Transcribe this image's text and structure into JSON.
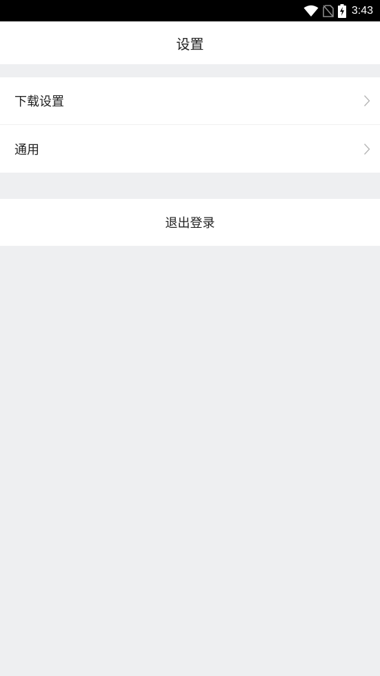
{
  "status_bar": {
    "time": "3:43",
    "icons": [
      "wifi-icon",
      "no-sim-icon",
      "battery-charging-icon"
    ]
  },
  "header": {
    "title": "设置"
  },
  "settings": {
    "items": [
      {
        "label": "下载设置",
        "icon": "chevron-right-icon"
      },
      {
        "label": "通用",
        "icon": "chevron-right-icon"
      }
    ]
  },
  "logout": {
    "label": "退出登录"
  },
  "colors": {
    "background": "#eeeff1",
    "surface": "#ffffff",
    "text": "#222222",
    "chevron": "#b5b5b5",
    "status_bar": "#000000"
  }
}
